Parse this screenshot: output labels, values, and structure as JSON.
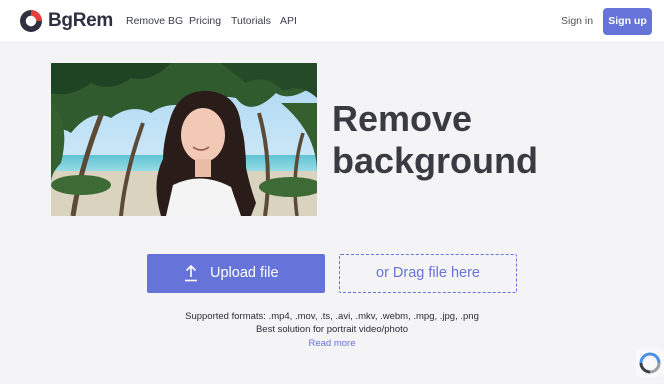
{
  "header": {
    "brand": "BgRem",
    "nav": [
      {
        "label": "Remove BG"
      },
      {
        "label": "Pricing"
      },
      {
        "label": "Tutorials"
      },
      {
        "label": "API"
      }
    ],
    "sign_in": "Sign in",
    "sign_up": "Sign up"
  },
  "hero": {
    "title_line1": "Remove",
    "title_line2": "background"
  },
  "actions": {
    "upload_label": "Upload file",
    "drag_label": "or Drag file here"
  },
  "info": {
    "formats": "Supported formats: .mp4, .mov, .ts, .avi, .mkv, .webm, .mpg, .jpg, .png",
    "tagline": "Best solution for portrait video/photo",
    "read_more": "Read more"
  },
  "colors": {
    "accent": "#6673d8",
    "heading": "#3a3a42",
    "background": "#f4f4f7"
  }
}
